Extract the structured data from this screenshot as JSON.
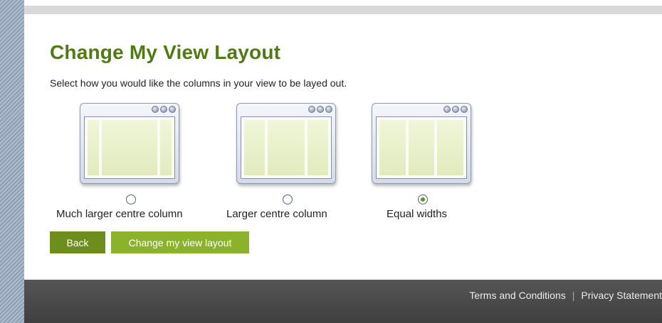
{
  "page": {
    "title": "Change My View Layout",
    "intro": "Select how you would like the columns in your view to be layed out."
  },
  "layout_options": [
    {
      "label": "Much larger centre column",
      "selected": false
    },
    {
      "label": "Larger centre column",
      "selected": false
    },
    {
      "label": "Equal widths",
      "selected": true
    }
  ],
  "buttons": {
    "back": "Back",
    "submit": "Change my view layout"
  },
  "footer": {
    "terms": "Terms and Conditions",
    "separator": "|",
    "privacy": "Privacy Statement"
  },
  "colors": {
    "title_green": "#4f7a14",
    "back_button": "#6d8d1c",
    "submit_button": "#8ab22a",
    "footer_bg": "#4a4a4a"
  }
}
